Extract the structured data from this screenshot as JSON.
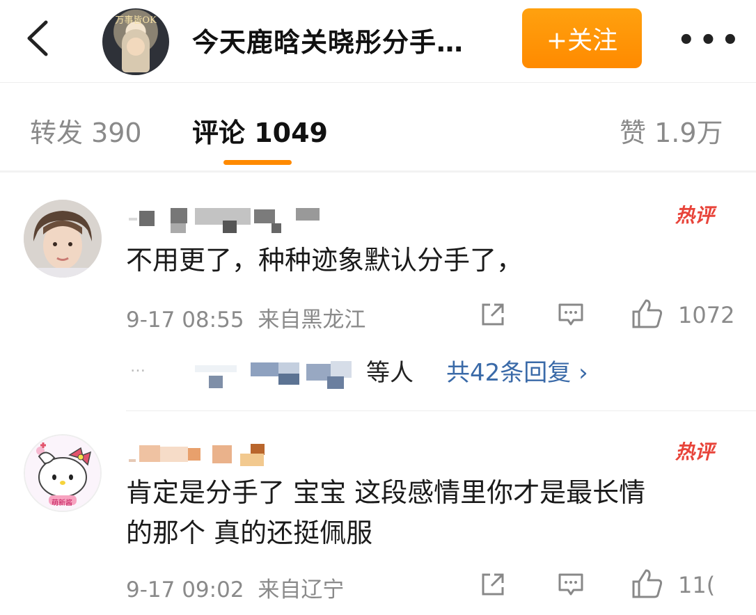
{
  "header": {
    "title": "今天鹿晗关晓彤分手…",
    "avatar_caption": "万事皆OK",
    "follow_label": "+关注",
    "more_label": "•••"
  },
  "tabs": [
    {
      "label": "转发 390"
    },
    {
      "label": "评论 1049"
    },
    {
      "label": "赞 1.9万"
    }
  ],
  "comments": [
    {
      "badge": "热评",
      "text": "不用更了，种种迹象默认分手了，",
      "time": "9-17 08:55",
      "location": "来自黑龙江",
      "likes": "1072",
      "reply_prefix": "…",
      "reply_suffix": "等人",
      "reply_link": "共42条回复 ›"
    },
    {
      "badge": "热评",
      "text_line1": "肯定是分手了 宝宝 这段感情里你才是最长情",
      "text_line2": "的那个 真的还挺佩服",
      "time": "9-17 09:02",
      "location": "来自辽宁",
      "likes": "11(",
      "avatar_caption": "萌新酱"
    }
  ],
  "colors": {
    "accent": "#ff8a00",
    "hot_badge": "#e8443a",
    "link": "#3a6aa8",
    "meta": "#8a8a8a"
  },
  "icons": [
    "chevron-left-icon",
    "share-icon",
    "comment-icon",
    "like-icon",
    "more-icon"
  ]
}
